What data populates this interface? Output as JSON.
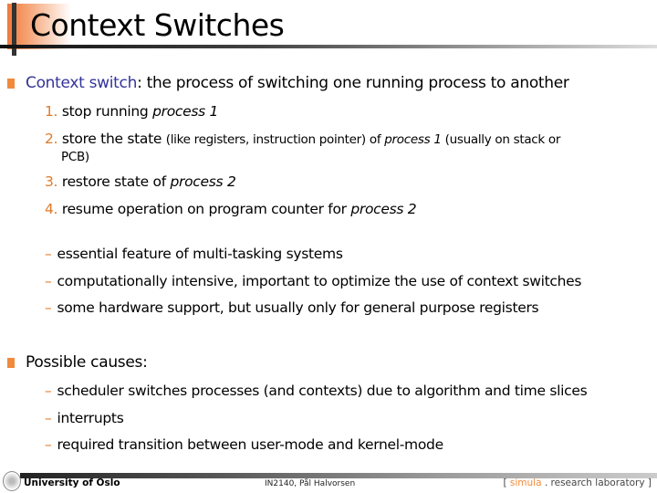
{
  "slide": {
    "title": "Context Switches",
    "bullets": [
      {
        "term": "Context switch",
        "text": ": the process of switching one running process to another",
        "steps": [
          {
            "num": "1.",
            "text": "stop running ",
            "italic": "process 1",
            "small": "",
            "tail": ""
          },
          {
            "num": "2.",
            "text": "store the state ",
            "small": "(like registers, instruction pointer) of ",
            "italic": "process 1",
            "tail": " (usually on stack or",
            "tail2": "PCB)"
          },
          {
            "num": "3.",
            "text": "restore state of ",
            "italic": "process 2"
          },
          {
            "num": "4.",
            "text": "resume operation on program counter for ",
            "italic": "process 2"
          }
        ],
        "notes": [
          "essential feature of multi-tasking systems",
          "computationally intensive, important to optimize the use of context switches",
          "some hardware support, but usually only for general purpose registers"
        ]
      },
      {
        "text": "Possible causes:",
        "notes": [
          "scheduler switches processes (and contexts) due to algorithm and time slices",
          "interrupts",
          "required transition between user-mode and kernel-mode"
        ]
      }
    ],
    "dash_symbol": "–"
  },
  "footer": {
    "institution": "University of Oslo",
    "course": "IN2140,  Pål Halvorsen",
    "lab_open": "[ ",
    "lab_brand": "simula",
    "lab_rest": " . research laboratory ]"
  },
  "colors": {
    "accent": "#f08a3c",
    "term": "#333399"
  }
}
